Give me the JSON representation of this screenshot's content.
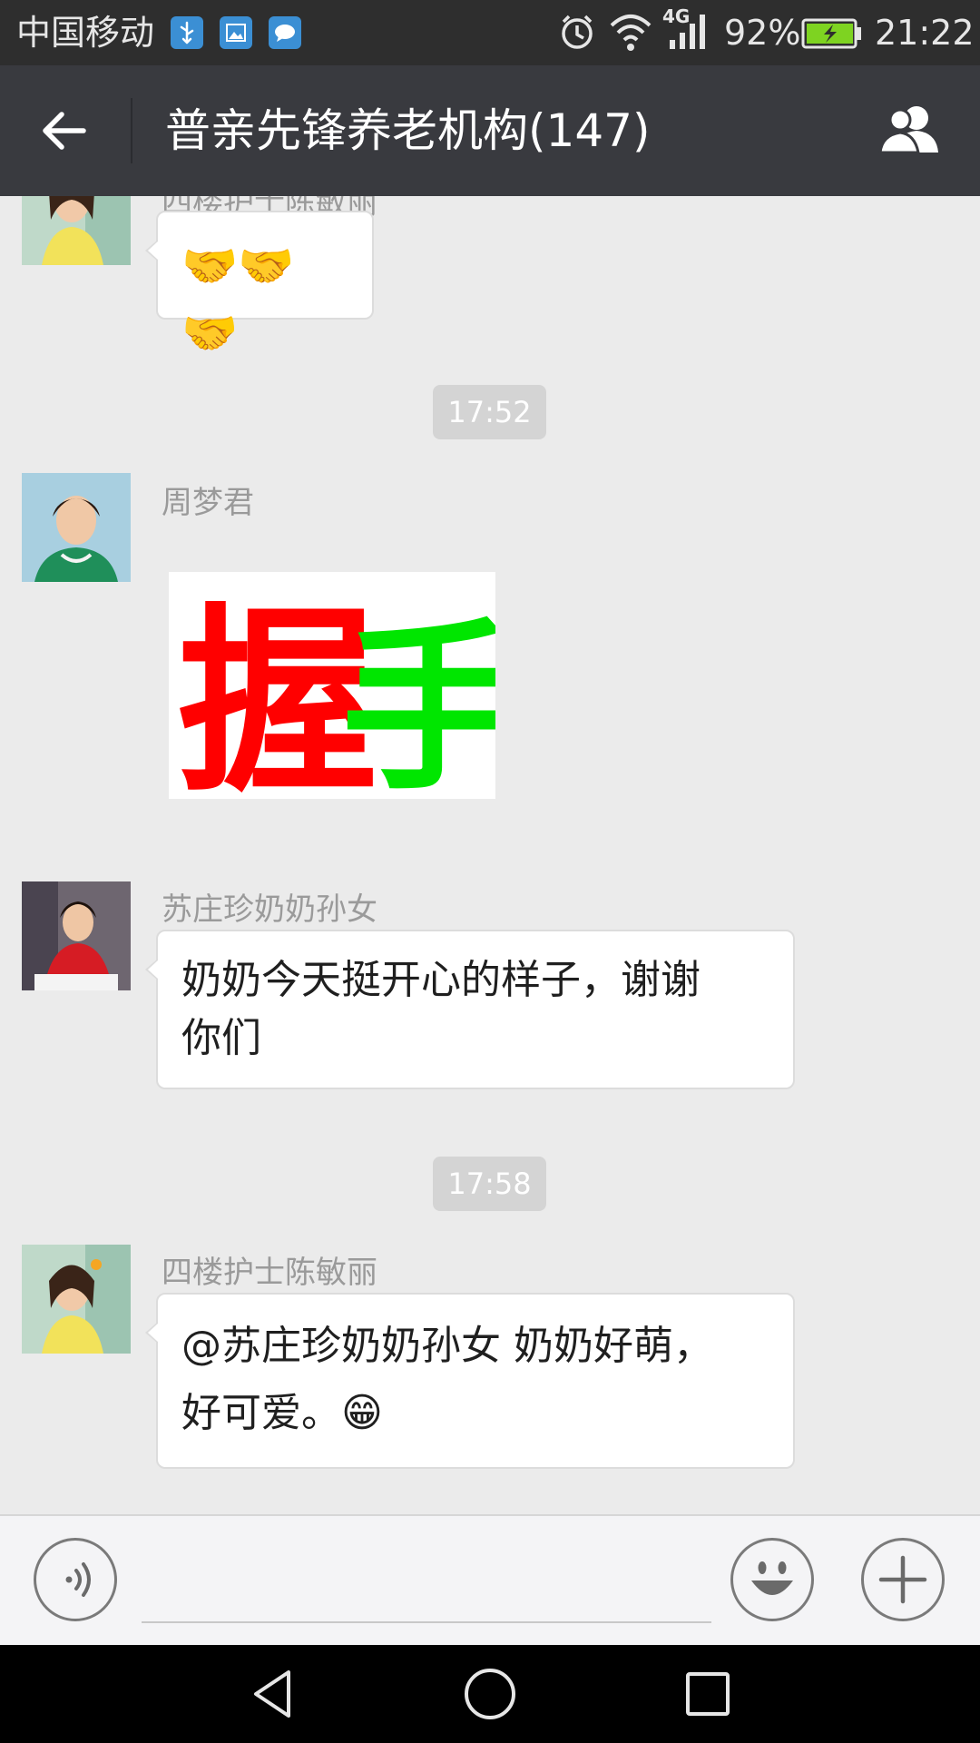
{
  "status_bar": {
    "carrier": "中国移动",
    "network": "4G",
    "battery_percent": "92%",
    "time": "21:22",
    "icons": [
      "usb-icon",
      "gallery-icon",
      "chat-notification-icon",
      "alarm-icon",
      "wifi-icon",
      "signal-icon",
      "battery-charging-icon"
    ]
  },
  "header": {
    "title": "普亲先锋养老机构(147)",
    "back_icon": "back-arrow-icon",
    "members_icon": "group-members-icon"
  },
  "chat": {
    "messages": [
      {
        "sender": "四楼护士陈敏丽",
        "type": "text",
        "text": "🤝🤝🤝"
      },
      {
        "type": "timestamp",
        "text": "17:52"
      },
      {
        "sender": "周梦君",
        "type": "sticker",
        "sticker_chars": [
          "握",
          "手"
        ],
        "sticker_colors": [
          "#ff0000",
          "#00e600"
        ]
      },
      {
        "sender": "苏庄珍奶奶孙女",
        "type": "text",
        "text_lines": [
          "奶奶今天挺开心的样子，谢谢",
          "你们"
        ]
      },
      {
        "type": "timestamp",
        "text": "17:58"
      },
      {
        "sender": "四楼护士陈敏丽",
        "type": "text",
        "text_lines": [
          "@苏庄珍奶奶孙女 奶奶好萌，",
          "好可爱。😁"
        ]
      }
    ]
  },
  "input_bar": {
    "voice_icon": "voice-input-icon",
    "emoji_icon": "emoji-icon",
    "plus_icon": "plus-icon",
    "placeholder": ""
  },
  "nav_bar": {
    "icons": [
      "nav-back-icon",
      "nav-home-icon",
      "nav-recents-icon"
    ]
  },
  "colors": {
    "status_bar_bg": "#2e2e2e",
    "title_bar_bg": "#393a3f",
    "chat_bg": "#ebebeb",
    "bubble_bg": "#ffffff",
    "timestamp_bg": "#d4d4d4",
    "battery_green": "#7ed321"
  }
}
